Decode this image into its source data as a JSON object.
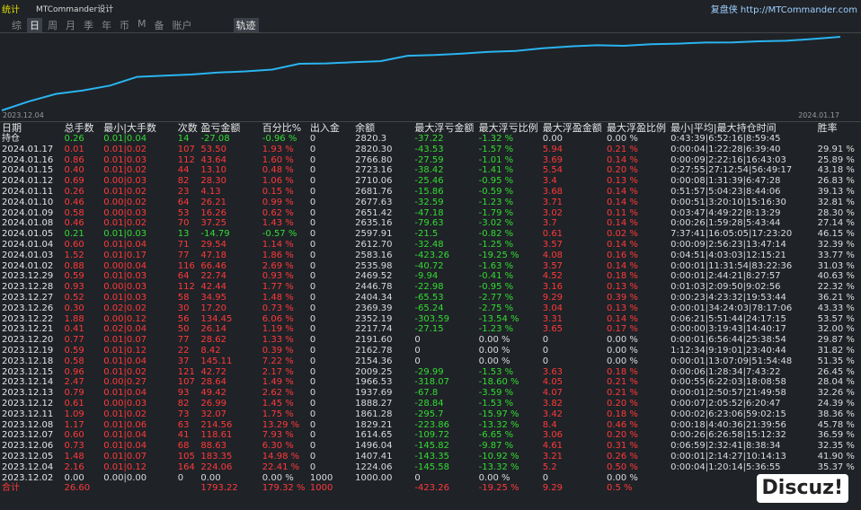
{
  "top": {
    "logo": "统计",
    "logo2": "MTCommander设计",
    "brand": "复盘侠 http://MTCommander.com"
  },
  "tabs": [
    "综",
    "日",
    "周",
    "月",
    "季",
    "年",
    "币",
    "M",
    "备",
    "账户",
    "轨迹"
  ],
  "active_tab": "日",
  "chart": {
    "start": "2023.12.04",
    "end": "2024.01.17"
  },
  "headers": [
    "日期",
    "总手数",
    "最小|大手数",
    "次数",
    "盈亏金额",
    "百分比%",
    "出入金",
    "余额",
    "最大浮亏金额",
    "最大浮亏比例",
    "最大浮盈金额",
    "最大浮盈比例",
    "最小|平均|最大持仓时间",
    "胜率"
  ],
  "rows": [
    [
      "持仓",
      "0.26",
      "0.01|0.04",
      "14",
      "-27.08",
      "-0.96 %",
      "0",
      "2820.3",
      "-37.22",
      "-1.32 %",
      "0.00",
      "0.00 %",
      "0:43:39|6:52:16|8:59:45",
      ""
    ],
    [
      "2024.01.17",
      "0.01",
      "0.01|0.02",
      "107",
      "53.50",
      "1.93 %",
      "0",
      "2820.30",
      "-43.53",
      "-1.57 %",
      "5.94",
      "0.21 %",
      "0:00:04|1:22:28|6:39:40",
      "29.91 %"
    ],
    [
      "2024.01.16",
      "0.86",
      "0.01|0.03",
      "112",
      "43.64",
      "1.60 %",
      "0",
      "2766.80",
      "-27.59",
      "-1.01 %",
      "3.69",
      "0.14 %",
      "0:00:09|2:22:16|16:43:03",
      "25.89 %"
    ],
    [
      "2024.01.15",
      "0.40",
      "0.01|0.02",
      "44",
      "13.10",
      "0.48 %",
      "0",
      "2723.16",
      "-38.42",
      "-1.41 %",
      "5.54",
      "0.20 %",
      "0:27:55|27:12:54|56:49:17",
      "43.18 %"
    ],
    [
      "2024.01.12",
      "0.69",
      "0.00|0.03",
      "82",
      "28.30",
      "1.06 %",
      "0",
      "2710.06",
      "-25.46",
      "-0.95 %",
      "3.4",
      "0.13 %",
      "0:00:08|1:31:39|6:47:28",
      "26.83 %"
    ],
    [
      "2024.01.11",
      "0.26",
      "0.01|0.02",
      "23",
      "4.13",
      "0.15 %",
      "0",
      "2681.76",
      "-15.86",
      "-0.59 %",
      "3.68",
      "0.14 %",
      "0:51:57|5:04:23|8:44:06",
      "39.13 %"
    ],
    [
      "2024.01.10",
      "0.46",
      "0.00|0.02",
      "64",
      "26.21",
      "0.99 %",
      "0",
      "2677.63",
      "-32.59",
      "-1.23 %",
      "3.71",
      "0.14 %",
      "0:00:51|3:20:10|15:16:30",
      "32.81 %"
    ],
    [
      "2024.01.09",
      "0.58",
      "0.00|0.03",
      "53",
      "16.26",
      "0.62 %",
      "0",
      "2651.42",
      "-47.18",
      "-1.79 %",
      "3.02",
      "0.11 %",
      "0:03:47|4:49:22|8:13:29",
      "28.30 %"
    ],
    [
      "2024.01.08",
      "0.46",
      "0.01|0.02",
      "70",
      "37.25",
      "1.43 %",
      "0",
      "2635.16",
      "-79.63",
      "-3.02 %",
      "3.7",
      "0.14 %",
      "0:00:26|1:59:28|5:43:44",
      "27.14 %"
    ],
    [
      "2024.01.05",
      "0.21",
      "0.01|0.03",
      "13",
      "-14.79",
      "-0.57 %",
      "0",
      "2597.91",
      "-21.5",
      "-0.82 %",
      "0.61",
      "0.02 %",
      "7:37:41|16:05:05|17:23:20",
      "46.15 %"
    ],
    [
      "2024.01.04",
      "0.60",
      "0.01|0.04",
      "71",
      "29.54",
      "1.14 %",
      "0",
      "2612.70",
      "-32.48",
      "-1.25 %",
      "3.57",
      "0.14 %",
      "0:00:09|2:56:23|13:47:14",
      "32.39 %"
    ],
    [
      "2024.01.03",
      "1.52",
      "0.01|0.17",
      "77",
      "47.18",
      "1.86 %",
      "0",
      "2583.16",
      "-423.26",
      "-19.25 %",
      "4.08",
      "0.16 %",
      "0:04:51|4:03:03|12:15:21",
      "33.77 %"
    ],
    [
      "2024.01.02",
      "0.88",
      "0.00|0.04",
      "116",
      "66.46",
      "2.69 %",
      "0",
      "2535.98",
      "-40.72",
      "-1.63 %",
      "3.57",
      "0.14 %",
      "0:00:01|11:31:54|83:22:36",
      "31.03 %"
    ],
    [
      "2023.12.29",
      "0.59",
      "0.01|0.03",
      "64",
      "22.74",
      "0.93 %",
      "0",
      "2469.52",
      "-9.94",
      "-0.41 %",
      "4.52",
      "0.18 %",
      "0:00:01|2:44:21|8:27:57",
      "40.63 %"
    ],
    [
      "2023.12.28",
      "0.93",
      "0.00|0.03",
      "112",
      "42.44",
      "1.77 %",
      "0",
      "2446.78",
      "-22.98",
      "-0.95 %",
      "3.16",
      "0.13 %",
      "0:01:03|2:09:50|9:02:56",
      "22.32 %"
    ],
    [
      "2023.12.27",
      "0.52",
      "0.01|0.03",
      "58",
      "34.95",
      "1.48 %",
      "0",
      "2404.34",
      "-65.53",
      "-2.77 %",
      "9.29",
      "0.39 %",
      "0:00:23|4:23:32|19:53:44",
      "36.21 %"
    ],
    [
      "2023.12.26",
      "0.30",
      "0.02|0.02",
      "30",
      "17.20",
      "0.73 %",
      "0",
      "2369.39",
      "-65.24",
      "-2.75 %",
      "3.04",
      "0.13 %",
      "0:00:01|34:24:03|78:17:06",
      "43.33 %"
    ],
    [
      "2023.12.22",
      "1.88",
      "0.00|0.12",
      "56",
      "134.45",
      "6.06 %",
      "0",
      "2352.19",
      "-303.59",
      "-13.54 %",
      "3.31",
      "0.14 %",
      "0:06:21|5:51:44|24:17:15",
      "53.57 %"
    ],
    [
      "2023.12.21",
      "0.41",
      "0.02|0.04",
      "50",
      "26.14",
      "1.19 %",
      "0",
      "2217.74",
      "-27.15",
      "-1.23 %",
      "3.65",
      "0.17 %",
      "0:00:00|3:19:43|14:40:17",
      "32.00 %"
    ],
    [
      "2023.12.20",
      "0.77",
      "0.01|0.07",
      "77",
      "28.62",
      "1.33 %",
      "0",
      "2191.60",
      "0",
      "0.00 %",
      "0",
      "0.00 %",
      "0:00:01|6:56:44|25:38:54",
      "29.87 %"
    ],
    [
      "2023.12.19",
      "0.59",
      "0.01|0.12",
      "22",
      "8.42",
      "0.39 %",
      "0",
      "2162.78",
      "0",
      "0.00 %",
      "0",
      "0.00 %",
      "1:12:34|9:19:01|23:40:44",
      "31.82 %"
    ],
    [
      "2023.12.18",
      "0.58",
      "0.01|0.04",
      "37",
      "145.11",
      "7.22 %",
      "0",
      "2154.36",
      "0",
      "0.00 %",
      "0",
      "0.00 %",
      "0:00:01|13:07:09|51:54:48",
      "51.35 %"
    ],
    [
      "2023.12.15",
      "0.96",
      "0.01|0.02",
      "121",
      "42.72",
      "2.17 %",
      "0",
      "2009.25",
      "-29.99",
      "-1.53 %",
      "3.63",
      "0.18 %",
      "0:00:06|1:28:34|7:43:22",
      "26.45 %"
    ],
    [
      "2023.12.14",
      "2.47",
      "0.00|0.27",
      "107",
      "28.64",
      "1.49 %",
      "0",
      "1966.53",
      "-318.07",
      "-18.60 %",
      "4.05",
      "0.21 %",
      "0:00:55|6:22:03|18:08:58",
      "28.04 %"
    ],
    [
      "2023.12.13",
      "0.79",
      "0.01|0.04",
      "93",
      "49.42",
      "2.62 %",
      "0",
      "1937.69",
      "-67.8",
      "-3.59 %",
      "4.07",
      "0.21 %",
      "0:00:01|2:50:57|21:49:58",
      "32.26 %"
    ],
    [
      "2023.12.12",
      "0.61",
      "0.00|0.03",
      "82",
      "26.99",
      "1.45 %",
      "0",
      "1888.27",
      "-28.84",
      "-1.53 %",
      "3.82",
      "0.20 %",
      "0:00:07|2:05:52|6:20:47",
      "24.39 %"
    ],
    [
      "2023.12.11",
      "1.09",
      "0.01|0.02",
      "73",
      "32.07",
      "1.75 %",
      "0",
      "1861.28",
      "-295.7",
      "-15.97 %",
      "3.42",
      "0.18 %",
      "0:00:02|6:23:06|59:02:15",
      "38.36 %"
    ],
    [
      "2023.12.08",
      "1.17",
      "0.01|0.06",
      "63",
      "214.56",
      "13.29 %",
      "0",
      "1829.21",
      "-223.86",
      "-13.32 %",
      "8.4",
      "0.46 %",
      "0:00:18|4:40:36|21:39:56",
      "45.78 %"
    ],
    [
      "2023.12.07",
      "0.60",
      "0.01|0.04",
      "41",
      "118.61",
      "7.93 %",
      "0",
      "1614.65",
      "-109.72",
      "-6.65 %",
      "3.06",
      "0.20 %",
      "0:00:26|6:26:58|15:12:32",
      "36.59 %"
    ],
    [
      "2023.12.06",
      "0.73",
      "0.01|0.04",
      "68",
      "88.63",
      "6.30 %",
      "0",
      "1496.04",
      "-145.82",
      "-9.87 %",
      "4.61",
      "0.31 %",
      "0:06:59|2:32:41|8:38:34",
      "32.35 %"
    ],
    [
      "2023.12.05",
      "1.48",
      "0.01|0.07",
      "105",
      "183.35",
      "14.98 %",
      "0",
      "1407.41",
      "-143.35",
      "-10.92 %",
      "3.21",
      "0.26 %",
      "0:00:01|2:14:27|10:14:13",
      "41.90 %"
    ],
    [
      "2023.12.04",
      "2.16",
      "0.01|0.12",
      "164",
      "224.06",
      "22.41 %",
      "0",
      "1224.06",
      "-145.58",
      "-13.32 %",
      "5.2",
      "0.50 %",
      "0:00:04|1:20:14|5:36:55",
      "35.37 %"
    ],
    [
      "2023.12.02",
      "0.00",
      "0.00|0.00",
      "0",
      "0.00",
      "0.00 %",
      "1000",
      "1000.00",
      "0",
      "0.00 %",
      "0",
      "0.00 %",
      "",
      ""
    ]
  ],
  "total": [
    "合计",
    "26.60",
    "",
    "",
    "1793.22",
    "179.32 %",
    "1000",
    "",
    "-423.26",
    "-19.25 %",
    "9.29",
    "0.5 %",
    "",
    ""
  ],
  "watermark": "Discuz!",
  "colors": {
    "positive": "#ff3a3a",
    "negative": "#33dd33",
    "curve": "#2ab4f0"
  }
}
